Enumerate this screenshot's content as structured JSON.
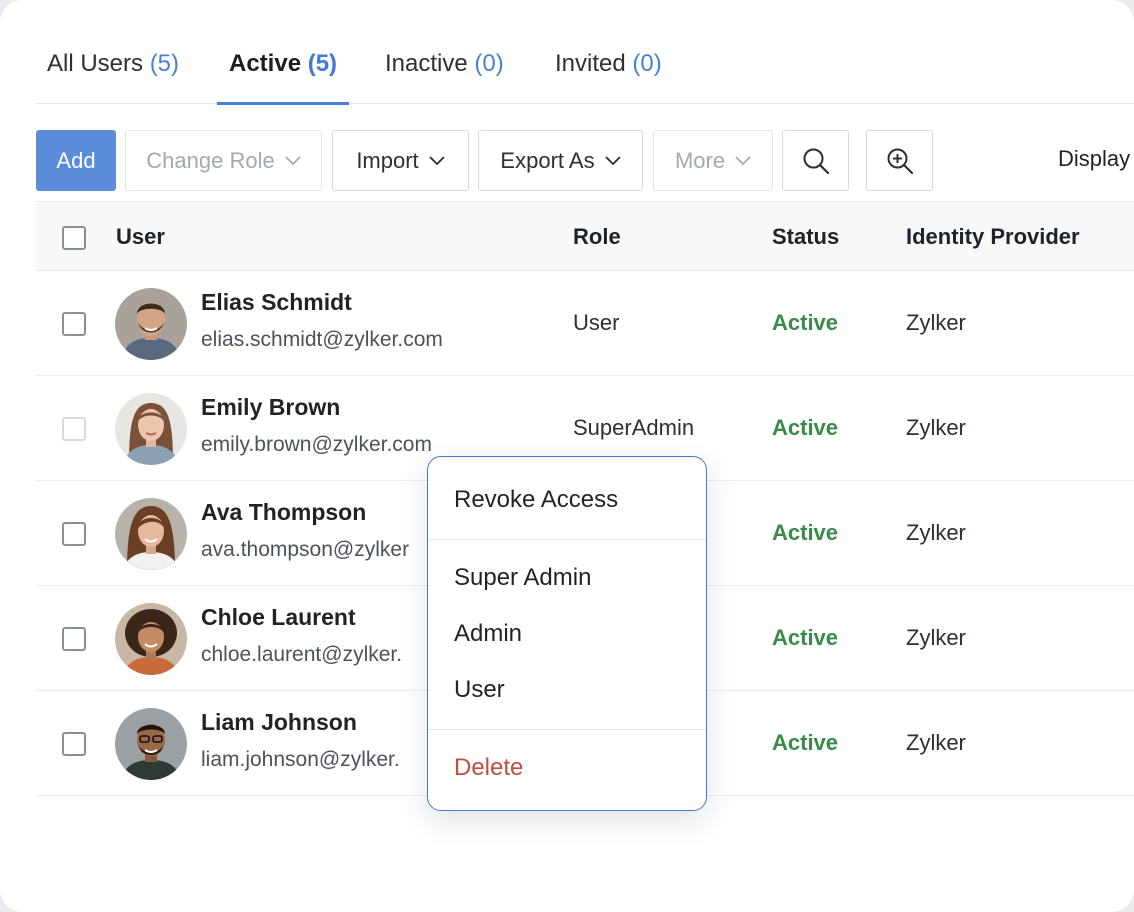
{
  "tabs": [
    {
      "label": "All Users",
      "count": "(5)"
    },
    {
      "label": "Active",
      "count": "(5)"
    },
    {
      "label": "Inactive",
      "count": "(0)"
    },
    {
      "label": "Invited",
      "count": "(0)"
    }
  ],
  "toolbar": {
    "add": "Add",
    "change_role": "Change Role",
    "import": "Import",
    "export_as": "Export As",
    "more": "More",
    "display": "Display"
  },
  "table": {
    "headers": {
      "user": "User",
      "role": "Role",
      "status": "Status",
      "identity_provider": "Identity Provider"
    },
    "rows": [
      {
        "name": "Elias Schmidt",
        "email": "elias.schmidt@zylker.com",
        "role": "User",
        "status": "Active",
        "idp": "Zylker"
      },
      {
        "name": "Emily Brown",
        "email": "emily.brown@zylker.com",
        "role": "SuperAdmin",
        "status": "Active",
        "idp": "Zylker"
      },
      {
        "name": "Ava Thompson",
        "email": "ava.thompson@zylker",
        "role": "",
        "status": "Active",
        "idp": "Zylker"
      },
      {
        "name": "Chloe Laurent",
        "email": "chloe.laurent@zylker.",
        "role": "",
        "status": "Active",
        "idp": "Zylker"
      },
      {
        "name": "Liam Johnson",
        "email": "liam.johnson@zylker.",
        "role": "",
        "status": "Active",
        "idp": "Zylker"
      }
    ]
  },
  "context_menu": {
    "revoke_access": "Revoke Access",
    "super_admin": "Super Admin",
    "admin": "Admin",
    "user": "User",
    "delete": "Delete"
  },
  "colors": {
    "accent": "#4a7fd6",
    "primary_button": "#5b8ddc",
    "status_active": "#3a8a49",
    "danger": "#c0503b"
  }
}
